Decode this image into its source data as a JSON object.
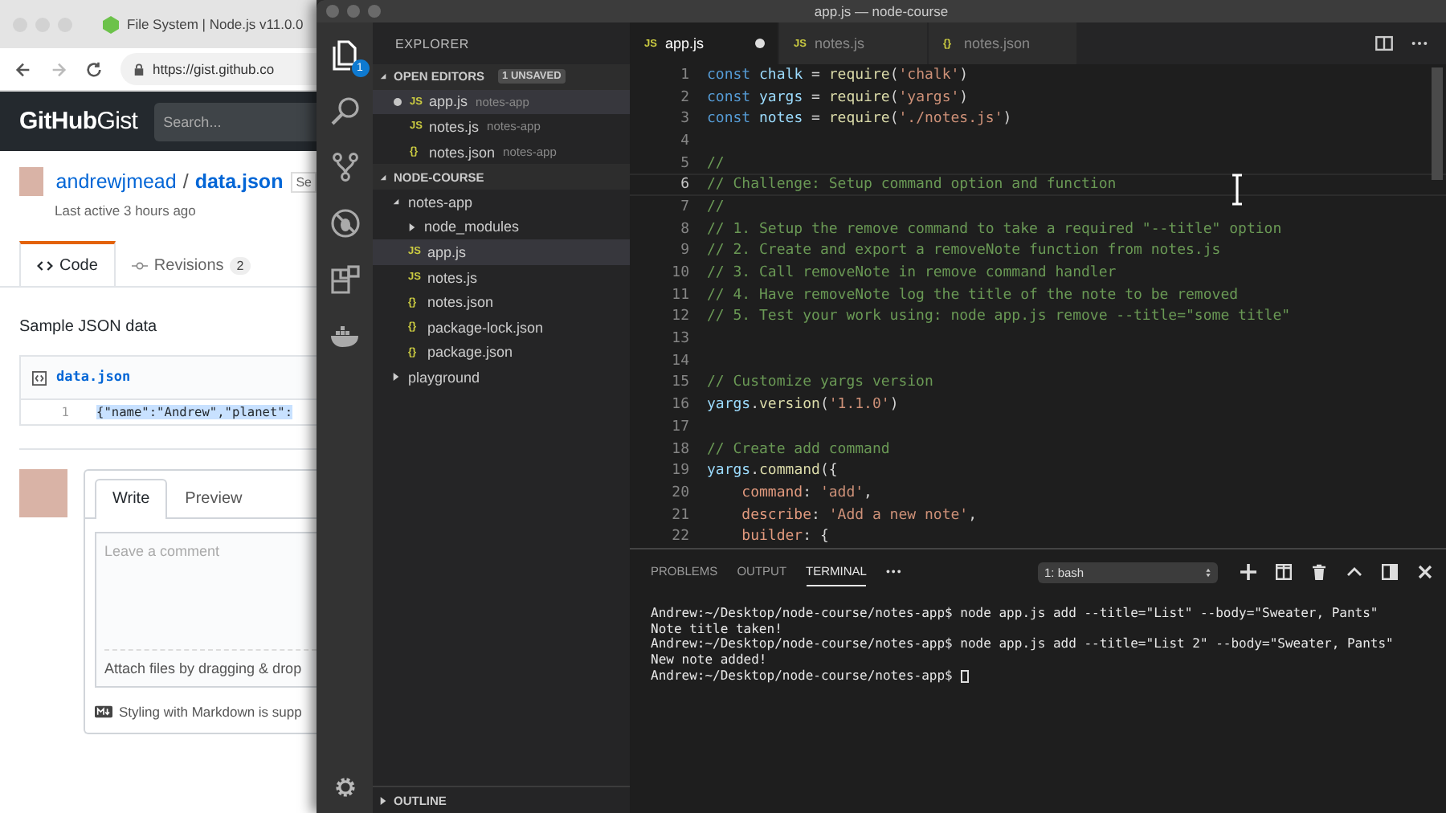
{
  "browser": {
    "tab_title": "File System | Node.js v11.0.0",
    "url": "https://gist.github.co",
    "logo": "**GitHub**Gist",
    "search": {
      "placeholder": "Search..."
    },
    "gist": {
      "owner": "andrewjmead",
      "separator": "/",
      "file": "data.json",
      "badge": "Se",
      "last_active": "Last active 3 hours ago"
    },
    "tabs": [
      {
        "label": "Code",
        "selected": true
      },
      {
        "label": "Revisions",
        "count": "2",
        "selected": false
      }
    ],
    "description": "Sample JSON data",
    "file": {
      "name": "data.json",
      "lines": [
        {
          "number": "1",
          "text": "{\"name\":\"Andrew\",\"planet\":",
          "selected": true
        }
      ]
    },
    "comment": {
      "tabs": [
        {
          "label": "Write",
          "selected": true
        },
        {
          "label": "Preview",
          "selected": false
        }
      ],
      "placeholder": "Leave a comment",
      "attach": "Attach files by dragging & drop",
      "markdown_note": "Styling with Markdown is supp"
    }
  },
  "vscode": {
    "window": {
      "title": "app.js — node-course"
    },
    "activity_bar": {
      "explorer_badge": "1"
    },
    "explorer": {
      "title": "EXPLORER",
      "open_editors": {
        "title": "OPEN EDITORS",
        "badge": "1 UNSAVED",
        "expanded": true,
        "items": [
          {
            "icon": "JS",
            "name": "app.js",
            "folder": "notes-app",
            "dirty": true,
            "selected": true
          },
          {
            "icon": "JS",
            "name": "notes.js",
            "folder": "notes-app",
            "dirty": false,
            "selected": false
          },
          {
            "icon": "{}",
            "name": "notes.json",
            "folder": "notes-app",
            "dirty": false,
            "selected": false
          }
        ]
      },
      "folder": {
        "title": "NODE-COURSE",
        "expanded": true,
        "tree": [
          {
            "kind": "folder",
            "name": "notes-app",
            "expanded": true,
            "selected": false,
            "children": [
              {
                "kind": "folder",
                "name": "node_modules",
                "expanded": false,
                "selected": false
              },
              {
                "kind": "file",
                "icon": "JS",
                "name": "app.js",
                "selected": true
              },
              {
                "kind": "file",
                "icon": "JS",
                "name": "notes.js",
                "selected": false
              },
              {
                "kind": "file",
                "icon": "{}",
                "name": "notes.json",
                "selected": false
              },
              {
                "kind": "file",
                "icon": "{}",
                "name": "package-lock.json",
                "selected": false
              },
              {
                "kind": "file",
                "icon": "{}",
                "name": "package.json",
                "selected": false
              }
            ]
          },
          {
            "kind": "folder",
            "name": "playground",
            "expanded": false,
            "selected": false
          }
        ]
      },
      "outline": {
        "title": "OUTLINE",
        "expanded": false
      }
    },
    "editor": {
      "tabs": [
        {
          "icon": "JS",
          "label": "app.js",
          "dirty": true,
          "selected": true
        },
        {
          "icon": "JS",
          "label": "notes.js",
          "dirty": false,
          "selected": false
        },
        {
          "icon": "{}",
          "label": "notes.json",
          "dirty": false,
          "selected": false
        }
      ],
      "lines": [
        {
          "number": "1",
          "current": false,
          "tokens": [
            {
              "kind": "keyword",
              "text": "const "
            },
            {
              "kind": "variable",
              "text": "chalk"
            },
            {
              "kind": "plain",
              "text": " = "
            },
            {
              "kind": "function",
              "text": "require"
            },
            {
              "kind": "plain",
              "text": "("
            },
            {
              "kind": "string",
              "text": "'chalk'"
            },
            {
              "kind": "plain",
              "text": ")"
            }
          ]
        },
        {
          "number": "2",
          "current": false,
          "tokens": [
            {
              "kind": "keyword",
              "text": "const "
            },
            {
              "kind": "variable",
              "text": "yargs"
            },
            {
              "kind": "plain",
              "text": " = "
            },
            {
              "kind": "function",
              "text": "require"
            },
            {
              "kind": "plain",
              "text": "("
            },
            {
              "kind": "string",
              "text": "'yargs'"
            },
            {
              "kind": "plain",
              "text": ")"
            }
          ]
        },
        {
          "number": "3",
          "current": false,
          "tokens": [
            {
              "kind": "keyword",
              "text": "const "
            },
            {
              "kind": "variable",
              "text": "notes"
            },
            {
              "kind": "plain",
              "text": " = "
            },
            {
              "kind": "function",
              "text": "require"
            },
            {
              "kind": "plain",
              "text": "("
            },
            {
              "kind": "string",
              "text": "'./notes.js'"
            },
            {
              "kind": "plain",
              "text": ")"
            }
          ]
        },
        {
          "number": "4",
          "current": false
        },
        {
          "number": "5",
          "current": false,
          "tokens": [
            {
              "kind": "comment",
              "text": "//"
            }
          ]
        },
        {
          "number": "6",
          "current": true,
          "tokens": [
            {
              "kind": "comment",
              "text": "// Challenge: Setup command option and function"
            }
          ]
        },
        {
          "number": "7",
          "current": false,
          "tokens": [
            {
              "kind": "comment",
              "text": "//"
            }
          ]
        },
        {
          "number": "8",
          "current": false,
          "tokens": [
            {
              "kind": "comment",
              "text": "// 1. Setup the remove command to take a required \"--title\" option"
            }
          ]
        },
        {
          "number": "9",
          "current": false,
          "tokens": [
            {
              "kind": "comment",
              "text": "// 2. Create and export a removeNote function from notes.js"
            }
          ]
        },
        {
          "number": "10",
          "current": false,
          "tokens": [
            {
              "kind": "comment",
              "text": "// 3. Call removeNote in remove command handler"
            }
          ]
        },
        {
          "number": "11",
          "current": false,
          "tokens": [
            {
              "kind": "comment",
              "text": "// 4. Have removeNote log the title of the note to be removed"
            }
          ]
        },
        {
          "number": "12",
          "current": false,
          "tokens": [
            {
              "kind": "comment",
              "text": "// 5. Test your work using: node app.js remove --title=\"some title\""
            }
          ]
        },
        {
          "number": "13",
          "current": false
        },
        {
          "number": "14",
          "current": false
        },
        {
          "number": "15",
          "current": false,
          "tokens": [
            {
              "kind": "comment",
              "text": "// Customize yargs version"
            }
          ]
        },
        {
          "number": "16",
          "current": false,
          "tokens": [
            {
              "kind": "variable",
              "text": "yargs"
            },
            {
              "kind": "plain",
              "text": "."
            },
            {
              "kind": "function",
              "text": "version"
            },
            {
              "kind": "plain",
              "text": "("
            },
            {
              "kind": "string",
              "text": "'1.1.0'"
            },
            {
              "kind": "plain",
              "text": ")"
            }
          ]
        },
        {
          "number": "17",
          "current": false
        },
        {
          "number": "18",
          "current": false,
          "tokens": [
            {
              "kind": "comment",
              "text": "// Create add command"
            }
          ]
        },
        {
          "number": "19",
          "current": false,
          "tokens": [
            {
              "kind": "variable",
              "text": "yargs"
            },
            {
              "kind": "plain",
              "text": "."
            },
            {
              "kind": "function",
              "text": "command"
            },
            {
              "kind": "plain",
              "text": "({"
            }
          ]
        },
        {
          "number": "20",
          "current": false,
          "tokens": [
            {
              "kind": "property",
              "text": "    command"
            },
            {
              "kind": "plain",
              "text": ": "
            },
            {
              "kind": "string",
              "text": "'add'"
            },
            {
              "kind": "plain",
              "text": ","
            }
          ]
        },
        {
          "number": "21",
          "current": false,
          "tokens": [
            {
              "kind": "property",
              "text": "    describe"
            },
            {
              "kind": "plain",
              "text": ": "
            },
            {
              "kind": "string",
              "text": "'Add a new note'"
            },
            {
              "kind": "plain",
              "text": ","
            }
          ]
        },
        {
          "number": "22",
          "current": false,
          "tokens": [
            {
              "kind": "property",
              "text": "    builder"
            },
            {
              "kind": "plain",
              "text": ": {"
            }
          ]
        }
      ]
    },
    "panel": {
      "tabs": [
        {
          "label": "PROBLEMS",
          "selected": false
        },
        {
          "label": "OUTPUT",
          "selected": false
        },
        {
          "label": "TERMINAL",
          "selected": true
        }
      ],
      "more": "•••",
      "shell": "1: bash",
      "cursor": true,
      "terminal_lines": [
        "Andrew:~/Desktop/node-course/notes-app$ node app.js add --title=\"List\" --body=\"Sweater, Pants\"",
        "Note title taken!",
        "Andrew:~/Desktop/node-course/notes-app$ node app.js add --title=\"List 2\" --body=\"Sweater, Pants\"",
        "New note added!",
        "Andrew:~/Desktop/node-course/notes-app$ "
      ]
    }
  }
}
